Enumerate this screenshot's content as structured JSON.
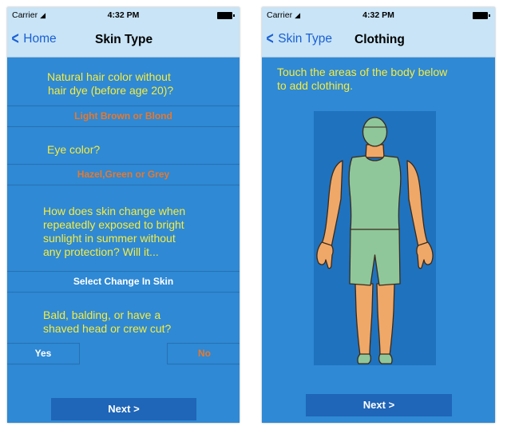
{
  "left_screen": {
    "status": {
      "carrier": "Carrier",
      "time": "4:32 PM"
    },
    "nav": {
      "back_label": "Home",
      "title": "Skin Type"
    },
    "q1": {
      "line1": "Natural hair color without",
      "line2": "hair dye (before age 20)?"
    },
    "q1_answer": "Light Brown or Blond",
    "q2": {
      "line1": "Eye color?"
    },
    "q2_answer": "Hazel,Green or Grey",
    "q3": {
      "line1": "How does skin change when",
      "line2": "repeatedly exposed to bright",
      "line3": "sunlight in summer without",
      "line4": "any protection? Will it..."
    },
    "q3_answer": "Select Change In Skin",
    "q4": {
      "line1": "Bald, balding, or have a",
      "line2": "shaved head or crew cut?"
    },
    "yes_label": "Yes",
    "no_label": "No",
    "next_label": "Next >"
  },
  "right_screen": {
    "status": {
      "carrier": "Carrier",
      "time": "4:32 PM"
    },
    "nav": {
      "back_label": "Skin Type",
      "title": "Clothing"
    },
    "instruction": {
      "line1": "Touch the areas of the body below",
      "line2": "to add clothing."
    },
    "next_label": "Next >"
  },
  "colors": {
    "screen_bg": "#2f89d4",
    "nav_bg": "#c8e4f6",
    "question_yellow": "#f6ec3f",
    "answer_orange": "#e9782b",
    "button_dark": "#1f65b8",
    "clothing_green": "#8fc79a",
    "skin": "#f0a868"
  },
  "icons": {
    "back": "chevron-left-icon",
    "wifi": "wifi-icon",
    "battery": "battery-icon"
  }
}
